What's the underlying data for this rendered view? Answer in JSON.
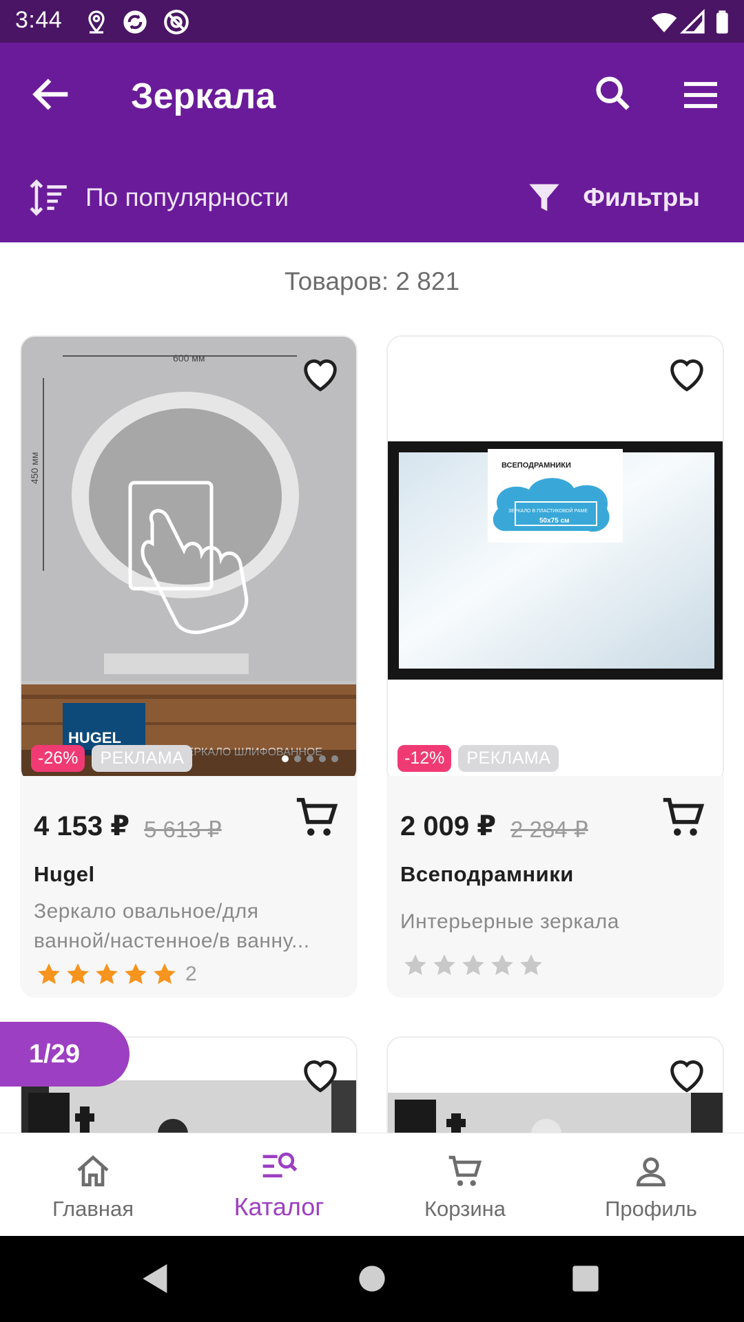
{
  "status_bar": {
    "time": "3:44"
  },
  "app_bar": {
    "title": "Зеркала",
    "sort_label": "По популярности",
    "filter_label": "Фильтры"
  },
  "catalog": {
    "count_text": "Товаров: 2 821"
  },
  "products": [
    {
      "discount": "-26%",
      "ad_label": "РЕКЛАМА",
      "price": "4 153 ₽",
      "old_price": "5 613 ₽",
      "brand": "Hugel",
      "desc_line1": "Зеркало овальное/для",
      "desc_line2": "ванной/настенное/в ванну...",
      "rating": 5,
      "rating_count": "2",
      "image_text_top": "600 мм",
      "image_text_side": "450 мм",
      "image_logo": "HUGEL",
      "image_caption": "ЗЕРКАЛО ШЛИФОВАННОЕ"
    },
    {
      "discount": "-12%",
      "ad_label": "РЕКЛАМА",
      "price": "2 009 ₽",
      "old_price": "2 284 ₽",
      "brand": "Всеподрамники",
      "desc_line1": "Интерьерные зеркала",
      "rating": 0,
      "image_label_brand": "ВСЕПОДРАМНИКИ",
      "image_label_line": "ЗЕРКАЛО В ПЛАСТИКОВОЙ РАМЕ",
      "image_label_size": "50x75 см"
    }
  ],
  "pagination": {
    "label": "1/29"
  },
  "bottom_nav": [
    {
      "label": "Главная",
      "icon": "home-icon"
    },
    {
      "label": "Каталог",
      "icon": "catalog-search-icon",
      "active": true
    },
    {
      "label": "Корзина",
      "icon": "cart-icon"
    },
    {
      "label": "Профиль",
      "icon": "profile-icon"
    }
  ],
  "colors": {
    "status_bar": "#4a1565",
    "app_bar": "#6a1b9a",
    "accent": "#9c3fc2",
    "discount_badge": "#f03a73",
    "star_filled": "#f7941d",
    "star_empty": "#c8c8c8"
  }
}
